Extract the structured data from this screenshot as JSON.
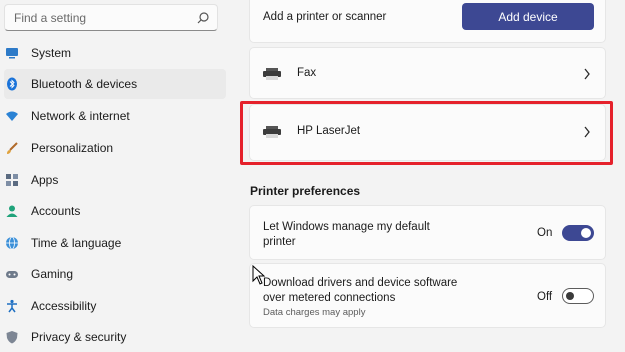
{
  "sidebar": {
    "search_placeholder": "Find a setting",
    "items": [
      {
        "label": "System",
        "icon": "monitor-icon"
      },
      {
        "label": "Bluetooth & devices",
        "icon": "bluetooth-icon"
      },
      {
        "label": "Network & internet",
        "icon": "wifi-icon"
      },
      {
        "label": "Personalization",
        "icon": "brush-icon"
      },
      {
        "label": "Apps",
        "icon": "apps-icon"
      },
      {
        "label": "Accounts",
        "icon": "person-icon"
      },
      {
        "label": "Time & language",
        "icon": "globe-icon"
      },
      {
        "label": "Gaming",
        "icon": "gamepad-icon"
      },
      {
        "label": "Accessibility",
        "icon": "accessibility-icon"
      },
      {
        "label": "Privacy & security",
        "icon": "shield-icon"
      }
    ],
    "active_item": "Bluetooth & devices"
  },
  "main": {
    "add_printer": {
      "label": "Add a printer or scanner",
      "button_label": "Add device"
    },
    "printers": [
      {
        "name": "Fax"
      },
      {
        "name": "HP LaserJet"
      }
    ],
    "preferences": {
      "title": "Printer preferences",
      "default_printer": {
        "label_line1": "Let Windows manage my default",
        "label_line2": "printer",
        "state": "On"
      },
      "metered": {
        "label_line1": "Download drivers and device software",
        "label_line2": "over metered connections",
        "sublabel": "Data charges may apply",
        "state": "Off"
      }
    }
  },
  "colors": {
    "accent": "#3d4893",
    "highlight": "#e5212b",
    "background": "#f3f3f3",
    "card": "#fbfbfb"
  }
}
